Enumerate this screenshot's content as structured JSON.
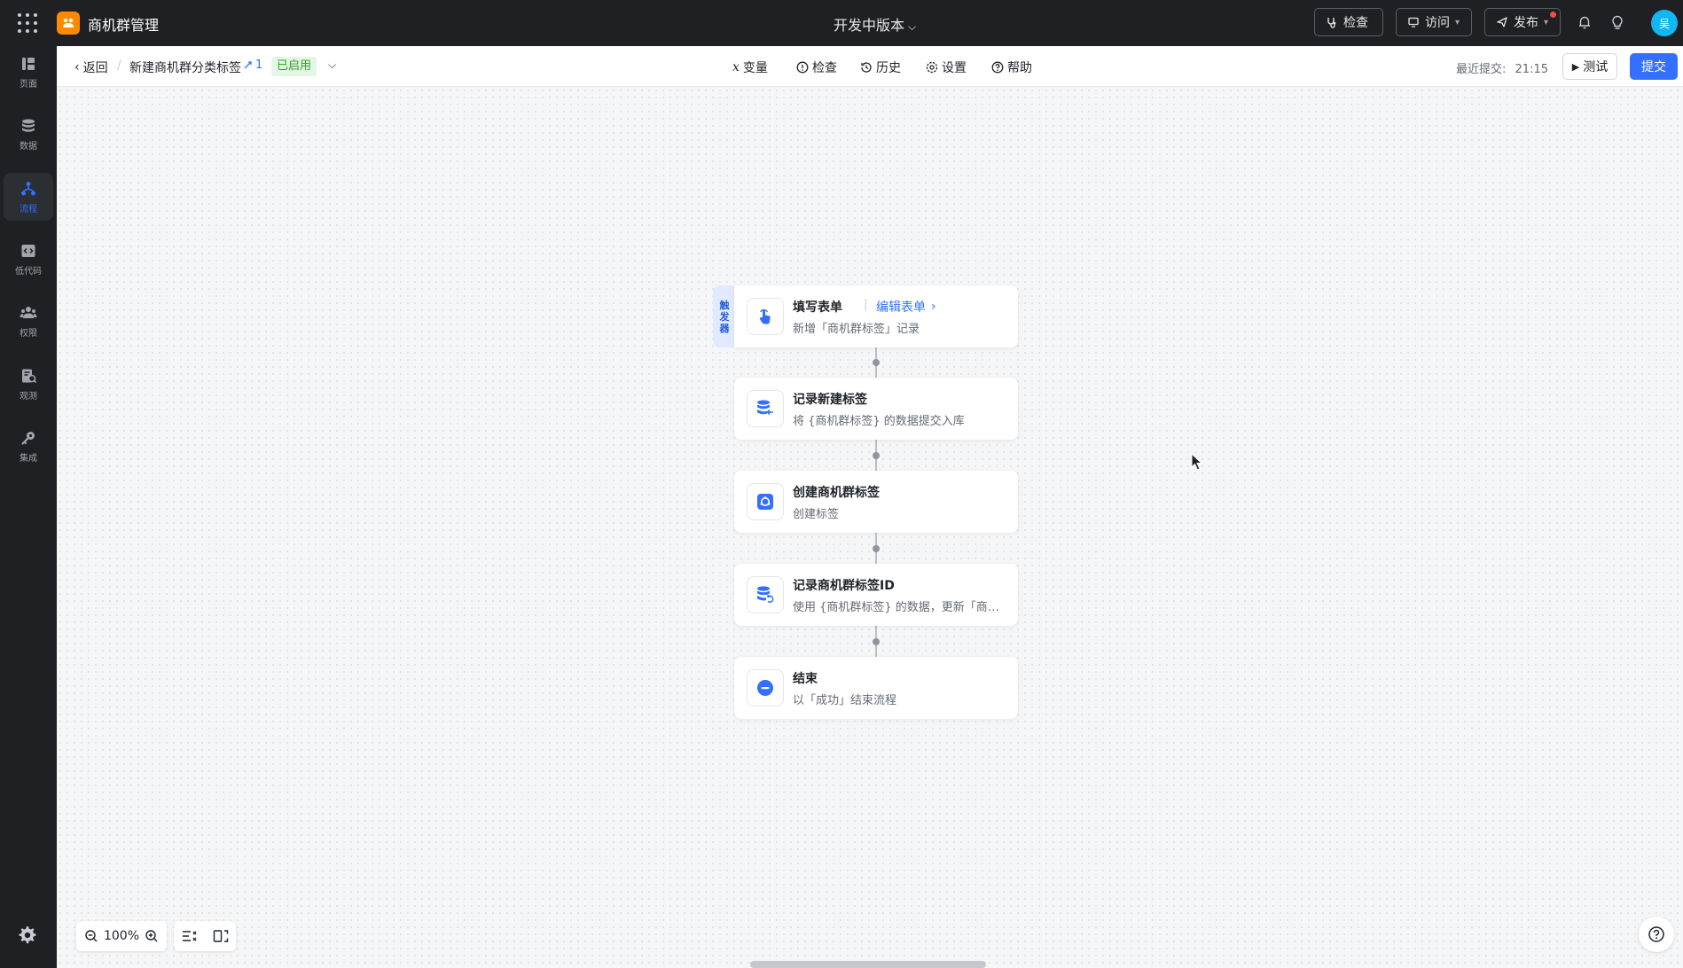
{
  "topbar": {
    "app_title": "商机群管理",
    "version_label": "开发中版本",
    "check_label": "检查",
    "visit_label": "访问",
    "publish_label": "发布",
    "avatar_text": "吴",
    "accent": "#3370ff"
  },
  "sidebar": {
    "items": [
      {
        "label": "页面",
        "icon": "pages-icon"
      },
      {
        "label": "数据",
        "icon": "database-icon"
      },
      {
        "label": "流程",
        "icon": "flow-icon",
        "active": true
      },
      {
        "label": "低代码",
        "icon": "code-icon"
      },
      {
        "label": "权限",
        "icon": "users-icon"
      },
      {
        "label": "观测",
        "icon": "monitor-icon"
      },
      {
        "label": "集成",
        "icon": "key-icon"
      }
    ]
  },
  "subheader": {
    "back_label": "返回",
    "flow_name": "新建商机群分类标签",
    "flow_count": "1",
    "status_badge": "已启用",
    "tools": [
      "变量",
      "检查",
      "历史",
      "设置",
      "帮助"
    ],
    "last_submit_label": "最近提交:",
    "last_submit_time": "21:15",
    "test_label": "测试",
    "submit_label": "提交"
  },
  "flow": {
    "trigger_tag": [
      "触",
      "发",
      "器"
    ],
    "nodes": [
      {
        "title": "填写表单",
        "link": "编辑表单",
        "desc": "新增「商机群标签」记录",
        "icon": "hand-pointer-icon"
      },
      {
        "title": "记录新建标签",
        "desc": "将 {商机群标签} 的数据提交入库",
        "icon": "database-add-icon"
      },
      {
        "title": "创建商机群标签",
        "desc": "创建标签",
        "icon": "plugin-icon"
      },
      {
        "title": "记录商机群标签ID",
        "desc": "使用 {商机群标签} 的数据，更新「商机群标签」记录",
        "icon": "database-update-icon"
      },
      {
        "title": "结束",
        "desc": "以「成功」结束流程",
        "icon": "end-icon"
      }
    ]
  },
  "canvas_controls": {
    "zoom_level": "100%"
  }
}
